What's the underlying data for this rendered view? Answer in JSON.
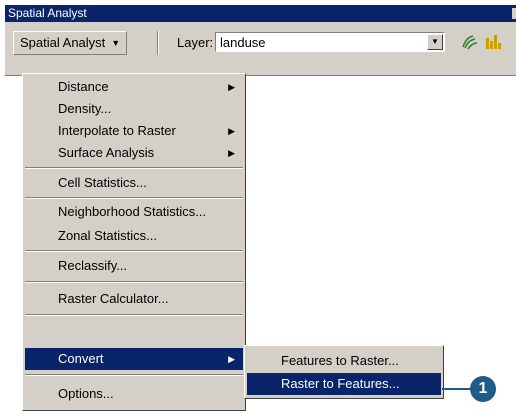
{
  "window": {
    "title": "Spatial Analyst"
  },
  "toolbar": {
    "menu_label": "Spatial Analyst",
    "menu_arrow": "▼",
    "layer_label": "Layer:",
    "layer_value": "landuse",
    "dropdown_arrow": "▼",
    "icons": [
      "histogram-icon",
      "histogram-bar-icon"
    ]
  },
  "menu": {
    "items": [
      {
        "label": "Distance",
        "has_submenu": true
      },
      {
        "label": "Density...",
        "has_submenu": false
      },
      {
        "label": "Interpolate to Raster",
        "has_submenu": true
      },
      {
        "label": "Surface Analysis",
        "has_submenu": true
      },
      {
        "label": "Cell Statistics...",
        "has_submenu": false
      },
      {
        "label": "Neighborhood Statistics...",
        "has_submenu": false
      },
      {
        "label": "Zonal Statistics...",
        "has_submenu": false
      },
      {
        "label": "Reclassify...",
        "has_submenu": false
      },
      {
        "label": "Raster Calculator...",
        "has_submenu": false
      },
      {
        "label": "Convert",
        "has_submenu": true
      },
      {
        "label": "Options...",
        "has_submenu": false
      }
    ],
    "submenu_arrow": "▶"
  },
  "submenu": {
    "items": [
      {
        "label": "Features to Raster..."
      },
      {
        "label": "Raster to Features..."
      }
    ]
  },
  "callout": {
    "number": "1"
  },
  "colors": {
    "highlight": "#0a246a",
    "face": "#d4d0c8",
    "callout": "#1e5a8a"
  }
}
